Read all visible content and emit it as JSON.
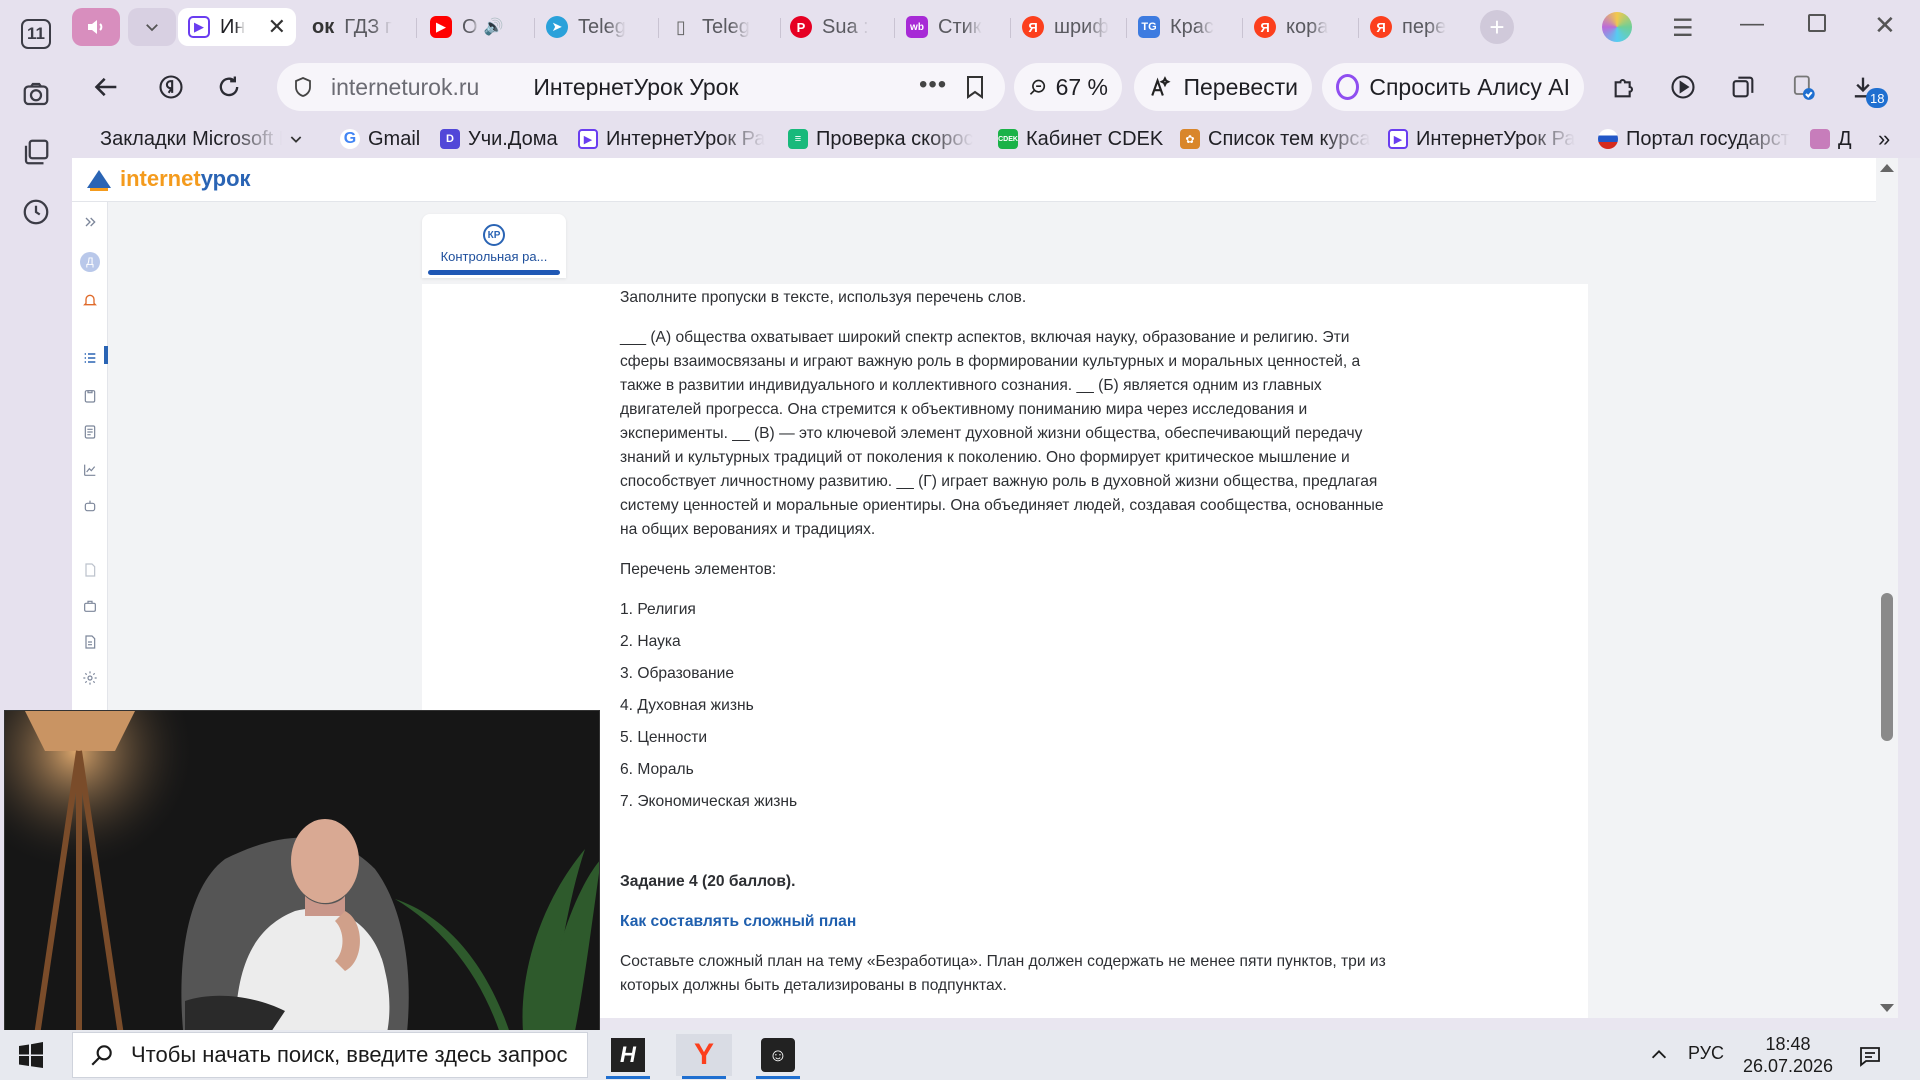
{
  "sidebar": {
    "counter": "11"
  },
  "tabs": [
    {
      "label": "Ин",
      "icon": "internet-urok-icon",
      "color": "#6a3df0"
    },
    {
      "label": "ГДЗ г",
      "icon": "ok-icon",
      "prefix": "ок"
    },
    {
      "label": "О",
      "icon": "youtube-icon",
      "color": "#ff0000"
    },
    {
      "label": "Teleg",
      "icon": "telegram-icon",
      "color": "#2aa1da"
    },
    {
      "label": "Teleg",
      "icon": "document-icon",
      "color": "#777"
    },
    {
      "label": "Sua :",
      "icon": "pinterest-icon",
      "color": "#e60023"
    },
    {
      "label": "Стик",
      "icon": "wildberries-icon",
      "color": "#a72ad6"
    },
    {
      "label": "шриф",
      "icon": "yandex-icon",
      "color": "#fc3f1d"
    },
    {
      "label": "Крас",
      "icon": "tg-icon",
      "color": "#3d7be0"
    },
    {
      "label": "кора",
      "icon": "yandex-icon",
      "color": "#fc3f1d"
    },
    {
      "label": "пере",
      "icon": "yandex-icon",
      "color": "#fc3f1d"
    }
  ],
  "toolbar": {
    "domain": "interneturok.ru",
    "page_title": "ИнтернетУрок Урок",
    "zoom": "67 %",
    "translate": "Перевести",
    "alice": "Спросить Алису AI",
    "downloads_badge": "18"
  },
  "bookmarks": [
    {
      "label": "Закладки Microsoft E",
      "icon": "folder-icon"
    },
    {
      "label": "Gmail",
      "icon": "google-icon",
      "color": "#4285f4"
    },
    {
      "label": "Учи.Дома",
      "icon": "uchi-icon",
      "color": "#5147d8"
    },
    {
      "label": "ИнтернетУрок Ра",
      "icon": "internet-urok-icon",
      "color": "#6a3df0"
    },
    {
      "label": "Проверка скорос",
      "icon": "speedtest-icon",
      "color": "#18b97b"
    },
    {
      "label": "Кабинет CDEK",
      "icon": "cdek-icon",
      "color": "#1ab248"
    },
    {
      "label": "Список тем курса",
      "icon": "course-icon",
      "color": "#d9862b"
    },
    {
      "label": "ИнтернетУрок Ра",
      "icon": "internet-urok-icon",
      "color": "#6a3df0"
    },
    {
      "label": "Портал государст",
      "icon": "gosuslugi-icon",
      "color": "#d52b1e"
    },
    {
      "label": "Д",
      "icon": "anime-icon",
      "color": "#c77dbb"
    }
  ],
  "site": {
    "logo_a": "internet",
    "logo_b": "урок",
    "kr_badge": "КР",
    "kr_label": "Контрольная ра..."
  },
  "content": {
    "instruction": "Заполните пропуски в тексте, используя перечень слов.",
    "passage": "___ (А) общества охватывает широкий спектр аспектов, включая науку, образование и религию. Эти сферы взаимосвязаны и играют важную роль в формировании культурных и моральных ценностей, а также в развитии индивидуального и коллективного сознания. __ (Б) является одним из главных двигателей прогресса. Она стремится к объективному пониманию мира через исследования и эксперименты. __ (В) — это ключевой элемент духовной жизни общества, обеспечивающий передачу знаний и культурных традиций от поколения к поколению. Оно формирует критическое мышление и способствует личностному развитию. __ (Г) играет важную роль в духовной жизни общества, предлагая систему ценностей и моральные ориентиры. Она объединяет людей, создавая сообщества, основанные на общих верованиях и традициях.",
    "list_title": "Перечень элементов:",
    "items": [
      "1. Религия",
      "2. Наука",
      "3. Образование",
      "4. Духовная жизнь",
      "5. Ценности",
      "6. Мораль",
      "7. Экономическая жизнь"
    ],
    "task_title": "Задание 4 (20 баллов).",
    "task_link": "Как составлять сложный план",
    "task_text": "Составьте сложный план на тему «Безработица». План должен содержать не менее пяти пунктов, три из которых должны быть детализированы в подпунктах."
  },
  "taskbar": {
    "search_placeholder": "Чтобы начать поиск, введите здесь запрос",
    "lang": "РУС",
    "time": "18:48",
    "date": "26.07.2026"
  }
}
